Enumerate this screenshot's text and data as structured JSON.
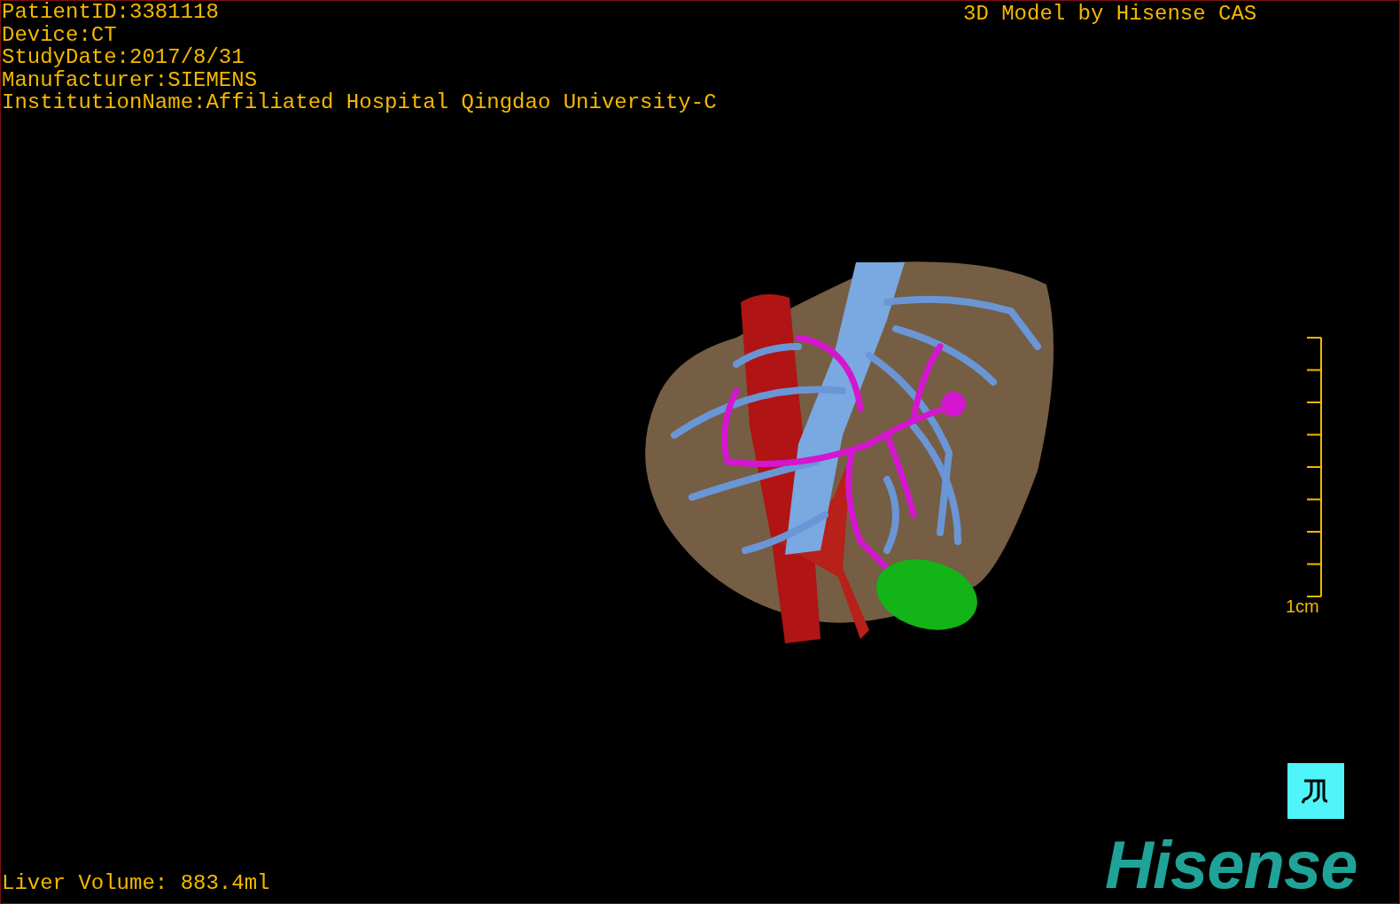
{
  "patient_info": [
    "PatientID:3381118",
    "Device:CT",
    "StudyDate:2017/8/31",
    "Manufacturer:SIEMENS",
    "InstitutionName:Affiliated Hospital Qingdao University-C"
  ],
  "model_caption": "3D Model by Hisense CAS",
  "scale_label": "1cm",
  "liver_volume": "Liver Volume: 883.4ml",
  "logo": "Hisense"
}
